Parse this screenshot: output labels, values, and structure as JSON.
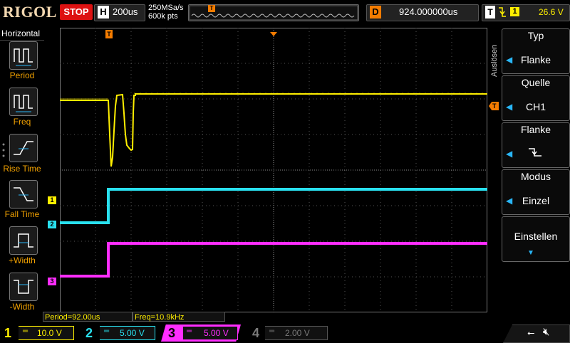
{
  "header": {
    "brand": "RIGOL",
    "run_state": "STOP",
    "timebase_label": "H",
    "timebase": "200us",
    "sample_rate": "250MSa/s",
    "memory_depth": "600k pts",
    "trigger_marker": "T",
    "delay_label": "D",
    "delay_value": "924.000000us",
    "trigger_label": "T",
    "trigger_source": "1",
    "trigger_level": "26.6 V"
  },
  "left_menu": {
    "title": "Horizontal",
    "items": [
      {
        "label": "Period"
      },
      {
        "label": "Freq"
      },
      {
        "label": "Rise Time"
      },
      {
        "label": "Fall Time"
      },
      {
        "label": "+Width"
      },
      {
        "label": "-Width"
      }
    ]
  },
  "right_menu": {
    "side_label": "Auslösen",
    "items": [
      {
        "title": "Typ",
        "value": "Flanke"
      },
      {
        "title": "Quelle",
        "value": "CH1"
      },
      {
        "title": "Flanke",
        "value": ""
      },
      {
        "title": "Modus",
        "value": "Einzel"
      },
      {
        "title": "Einstellen",
        "value": ""
      }
    ]
  },
  "markers": {
    "trigger_top": "T",
    "trigger_level": "T",
    "ch1": "1",
    "ch2": "2",
    "ch3": "3"
  },
  "measurements": {
    "period": "Period=92.00us",
    "freq": "Freq=10.9kHz"
  },
  "channels": [
    {
      "num": "1",
      "scale": "10.0 V",
      "color": "#ffef00",
      "active": true
    },
    {
      "num": "2",
      "scale": "5.00 V",
      "color": "#29e1f0",
      "active": true
    },
    {
      "num": "3",
      "scale": "5.00 V",
      "color": "#ff2dff",
      "active": true
    },
    {
      "num": "4",
      "scale": "2.00 V",
      "color": "#7a7a7a",
      "active": false
    }
  ],
  "colors": {
    "ch1": "#ffef00",
    "ch2": "#29e1f0",
    "ch3": "#ff2dff",
    "accent": "#f57c00",
    "menu_arrow": "#29b6f6"
  }
}
